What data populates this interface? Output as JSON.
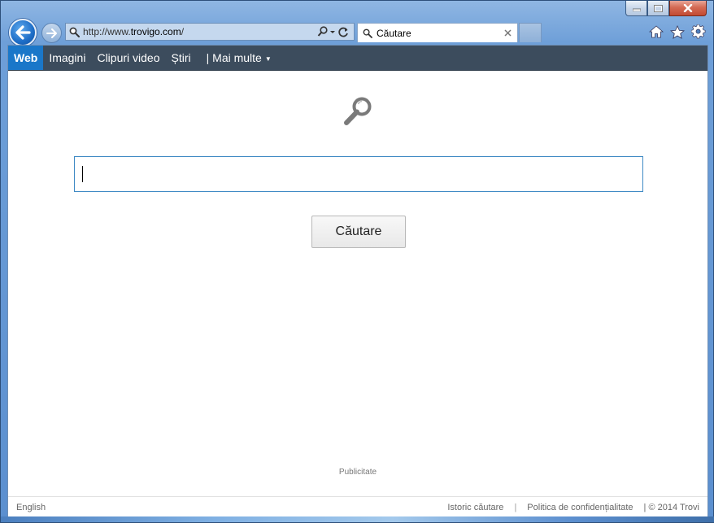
{
  "browser": {
    "address": {
      "prefix": "http://www.",
      "host": "trovigo.com",
      "suffix": "/"
    },
    "tab": {
      "title": "Căutare"
    }
  },
  "toolbar": {
    "items": [
      {
        "label": "Web",
        "active": true
      },
      {
        "label": "Imagini"
      },
      {
        "label": "Clipuri video"
      },
      {
        "label": "Știri"
      },
      {
        "label": "| Mai multe"
      }
    ]
  },
  "search": {
    "value": "",
    "button_label": "Căutare"
  },
  "ad_label": "Publicitate",
  "footer": {
    "language": "English",
    "history": "Istoric căutare",
    "privacy": "Politica de confidențialitate",
    "copyright": "| © 2014  Trovi"
  },
  "colors": {
    "toolbar_bg": "#3c4c5d",
    "active_tab": "#1a77c9",
    "input_border": "#3f8ac4"
  }
}
